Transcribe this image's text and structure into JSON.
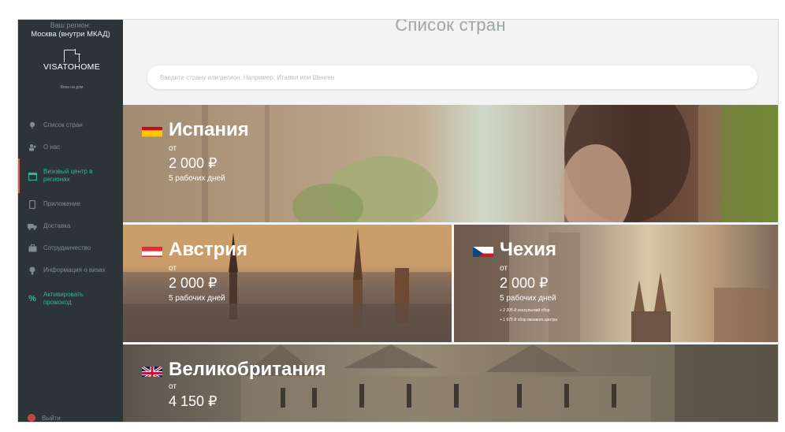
{
  "sidebar": {
    "region_label": "Ваш регион:",
    "region_value": "Москва (внутри МКАД)",
    "logo_text": "VISATOHOME",
    "logo_tagline": "Виза на дом",
    "items": [
      {
        "label": "Список стран",
        "icon": "globe-icon"
      },
      {
        "label": "О нас",
        "icon": "people-icon"
      },
      {
        "label": "Визовый центр в регионах",
        "icon": "calendar-icon"
      },
      {
        "label": "Приложение",
        "icon": "phone-icon"
      },
      {
        "label": "Доставка",
        "icon": "truck-icon"
      },
      {
        "label": "Сотрудничество",
        "icon": "briefcase-icon"
      },
      {
        "label": "Информация о визах",
        "icon": "info-icon"
      },
      {
        "label": "Активировать промокод",
        "icon": "percent-icon"
      }
    ],
    "exit_label": "Выйти",
    "active_index": 2,
    "accent_color": "#2fb79a",
    "active_marker_color": "#e25757"
  },
  "main": {
    "title": "Список стран",
    "search_placeholder": "Введите страну или регион. Например: Италия или Шенген"
  },
  "countries": [
    {
      "name": "Испания",
      "from": "от",
      "price": "2 000 ₽",
      "days": "5 рабочих дней",
      "notes": []
    },
    {
      "name": "Австрия",
      "from": "от",
      "price": "2 000 ₽",
      "days": "5 рабочих дней",
      "notes": []
    },
    {
      "name": "Чехия",
      "from": "от",
      "price": "2 000 ₽",
      "days": "5 рабочих дней",
      "notes": [
        "+ 2 205 ₽ консульский сбор",
        "+ 1 675 ₽ сбор визового центра"
      ]
    },
    {
      "name": "Великобритания",
      "from": "от",
      "price": "4 150 ₽",
      "days": "",
      "notes": []
    }
  ]
}
